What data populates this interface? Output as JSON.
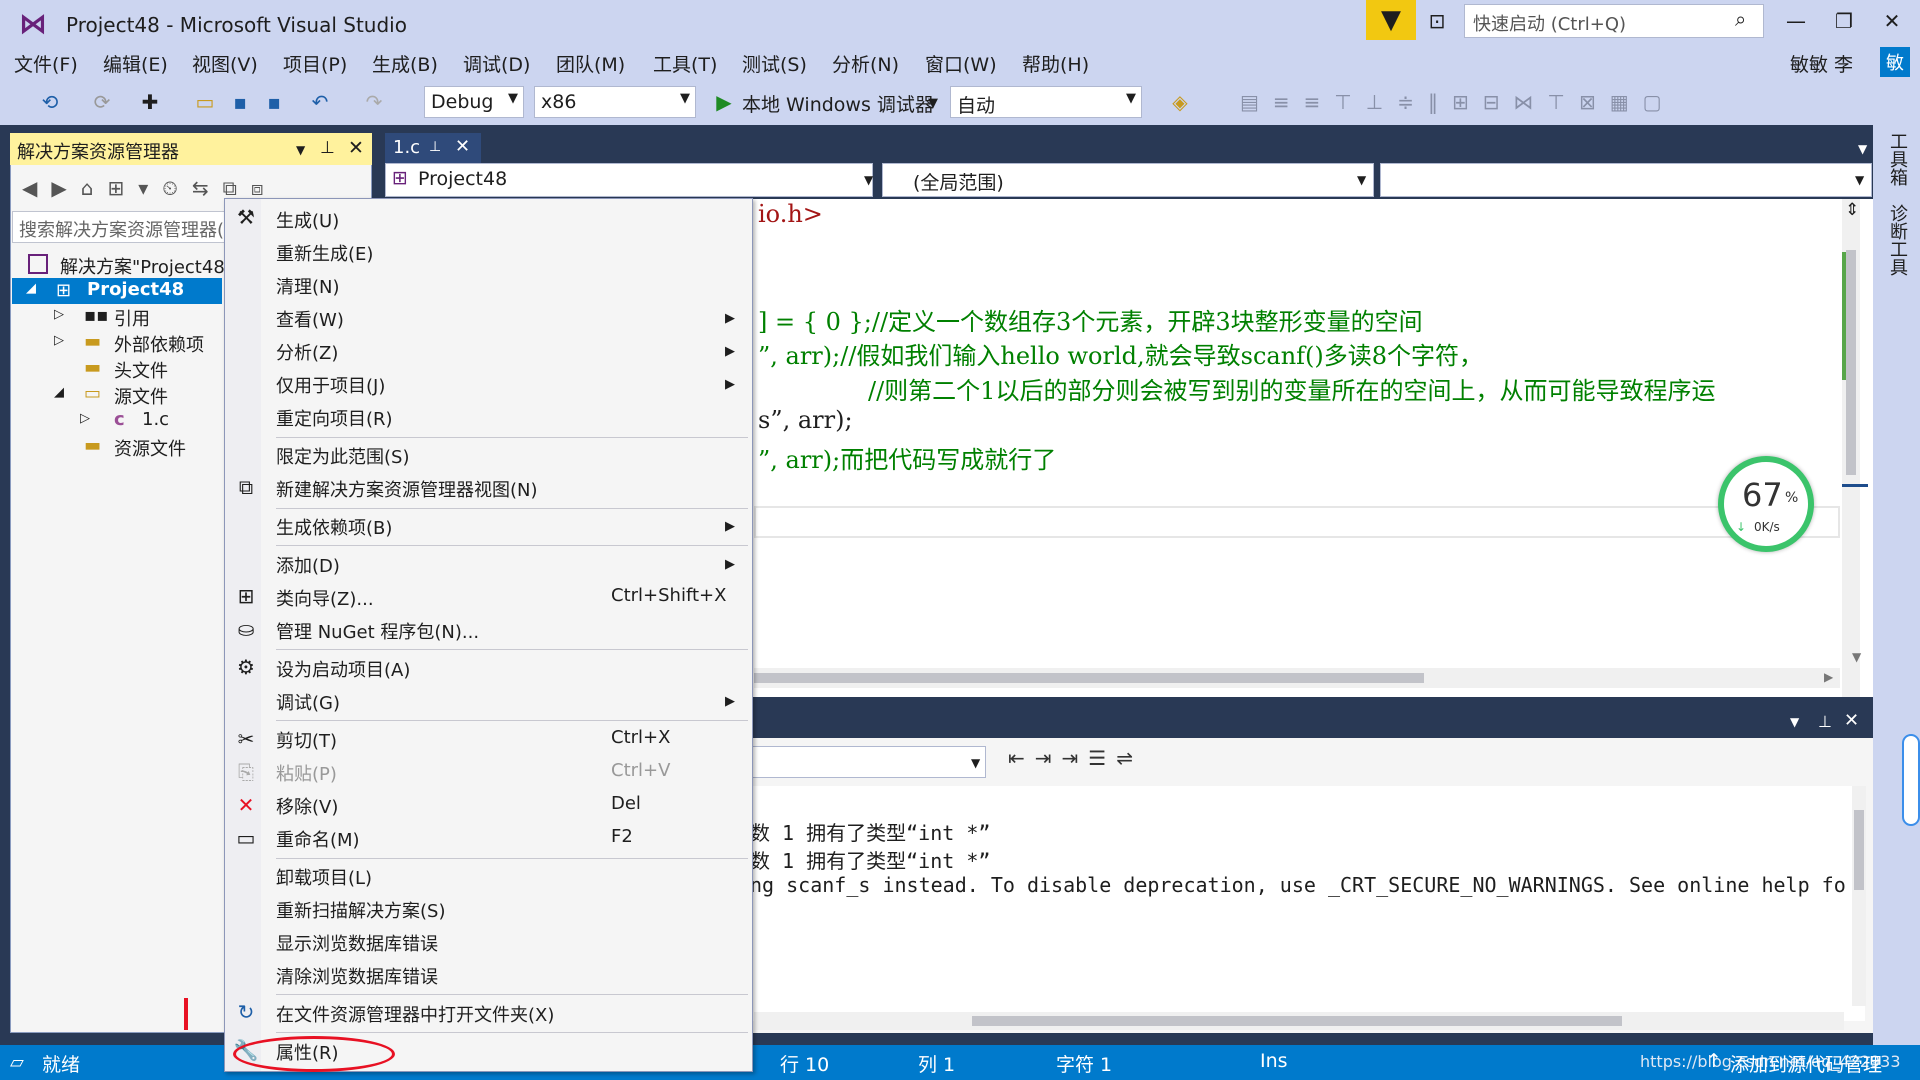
{
  "window": {
    "title": "Project48 - Microsoft Visual Studio",
    "quick_launch_placeholder": "快速启动 (Ctrl+Q)",
    "user": "敏敏 李"
  },
  "menu": [
    "文件(F)",
    "编辑(E)",
    "视图(V)",
    "项目(P)",
    "生成(B)",
    "调试(D)",
    "团队(M)",
    "工具(T)",
    "测试(S)",
    "分析(N)",
    "窗口(W)",
    "帮助(H)"
  ],
  "toolbar": {
    "config": "Debug",
    "platform": "x86",
    "run_label": "本地 Windows 调试器",
    "auto": "自动"
  },
  "solution_explorer": {
    "title": "解决方案资源管理器",
    "search_placeholder": "搜索解决方案资源管理器(",
    "items": [
      "解决方案\"Project48",
      "Project48",
      "引用",
      "外部依赖项",
      "头文件",
      "源文件",
      "1.c",
      "资源文件"
    ]
  },
  "editor": {
    "tab": "1.c",
    "nav_project": "Project48",
    "nav_scope": "(全局范围)",
    "code_lines": [
      "io.h>",
      "] = { 0 };//定义一个数组存3个元素，开辟3块整形变量的空间",
      "”, arr);//假如我们输入hello world,就会导致scanf()多读8个字符，",
      "//则第二个1以后的部分则会被写到别的变量所在的空间上，从而可能导致程序运",
      "s”, arr);",
      "”, arr);而把代码写成就行了"
    ]
  },
  "output": {
    "lines": [
      "数 1 拥有了类型“int *”",
      "数 1 拥有了类型“int *”",
      "ng scanf_s instead. To disable deprecation, use _CRT_SECURE_NO_WARNINGS. See online help fo"
    ]
  },
  "net_widget": {
    "percent": "67",
    "unit": "%",
    "speed": "0K/s"
  },
  "context_menu": [
    {
      "label": "生成(U)",
      "shortcut": "",
      "submenu": false,
      "icon": "build-icon"
    },
    {
      "label": "重新生成(E)",
      "shortcut": "",
      "submenu": false
    },
    {
      "label": "清理(N)",
      "shortcut": "",
      "submenu": false
    },
    {
      "label": "查看(W)",
      "shortcut": "",
      "submenu": true
    },
    {
      "label": "分析(Z)",
      "shortcut": "",
      "submenu": true
    },
    {
      "label": "仅用于项目(J)",
      "shortcut": "",
      "submenu": true
    },
    {
      "label": "重定向项目(R)",
      "shortcut": "",
      "submenu": false
    },
    {
      "label": "限定为此范围(S)",
      "shortcut": "",
      "submenu": false
    },
    {
      "label": "新建解决方案资源管理器视图(N)",
      "shortcut": "",
      "submenu": false
    },
    {
      "label": "生成依赖项(B)",
      "shortcut": "",
      "submenu": true
    },
    {
      "label": "添加(D)",
      "shortcut": "",
      "submenu": true
    },
    {
      "label": "类向导(Z)...",
      "shortcut": "Ctrl+Shift+X",
      "submenu": false
    },
    {
      "label": "管理 NuGet 程序包(N)...",
      "shortcut": "",
      "submenu": false
    },
    {
      "label": "设为启动项目(A)",
      "shortcut": "",
      "submenu": false
    },
    {
      "label": "调试(G)",
      "shortcut": "",
      "submenu": true
    },
    {
      "label": "剪切(T)",
      "shortcut": "Ctrl+X",
      "submenu": false
    },
    {
      "label": "粘贴(P)",
      "shortcut": "Ctrl+V",
      "submenu": false
    },
    {
      "label": "移除(V)",
      "shortcut": "Del",
      "submenu": false
    },
    {
      "label": "重命名(M)",
      "shortcut": "F2",
      "submenu": false
    },
    {
      "label": "卸载项目(L)",
      "shortcut": "",
      "submenu": false
    },
    {
      "label": "重新扫描解决方案(S)",
      "shortcut": "",
      "submenu": false
    },
    {
      "label": "显示浏览数据库错误",
      "shortcut": "",
      "submenu": false
    },
    {
      "label": "清除浏览数据库错误",
      "shortcut": "",
      "submenu": false
    },
    {
      "label": "在文件资源管理器中打开文件夹(X)",
      "shortcut": "",
      "submenu": false
    },
    {
      "label": "属性(R)",
      "shortcut": "",
      "submenu": false
    }
  ],
  "statusbar": {
    "ready": "就绪",
    "line": "行 10",
    "col": "列 1",
    "char": "字符 1",
    "ins": "Ins",
    "source_control": "添加到源代码管理",
    "watermark": "https://blog.csdn.net/qq_422933"
  },
  "right_sidebar": [
    "工具箱",
    "诊断工具"
  ],
  "colors": {
    "accent": "#007acc",
    "chrome": "#ccd5f0",
    "dark_bg": "#293955",
    "highlight": "#fff29d",
    "annotation": "#e81123"
  }
}
